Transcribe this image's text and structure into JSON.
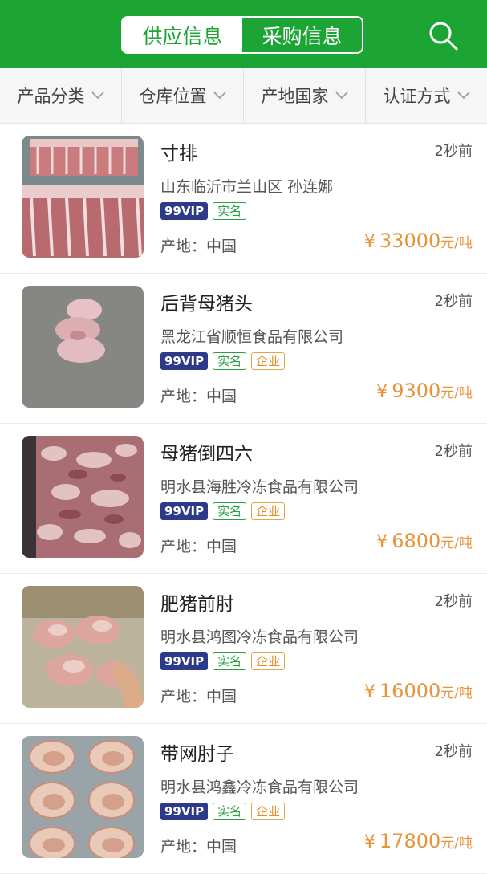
{
  "header": {
    "tabs": [
      {
        "label": "供应信息",
        "active": true
      },
      {
        "label": "采购信息",
        "active": false
      }
    ],
    "search_icon": "search-icon",
    "brand_color": "#1ca434"
  },
  "filters": [
    {
      "label": "产品分类"
    },
    {
      "label": "仓库位置"
    },
    {
      "label": "产地国家"
    },
    {
      "label": "认证方式"
    }
  ],
  "listings": [
    {
      "title": "寸排",
      "time": "2秒前",
      "company": "山东临沂市兰山区  孙连娜",
      "vip": "99VIP",
      "verified": "实名",
      "enterprise": "",
      "origin": "产地：中国",
      "currency": "¥",
      "price": "33000",
      "unit": "元/吨"
    },
    {
      "title": "后背母猪头",
      "time": "2秒前",
      "company": "黑龙江省顺恒食品有限公司",
      "vip": "99VIP",
      "verified": "实名",
      "enterprise": "企业",
      "origin": "产地：中国",
      "currency": "¥",
      "price": "9300",
      "unit": "元/吨"
    },
    {
      "title": "母猪倒四六",
      "time": "2秒前",
      "company": "明水县海胜冷冻食品有限公司",
      "vip": "99VIP",
      "verified": "实名",
      "enterprise": "企业",
      "origin": "产地：中国",
      "currency": "¥",
      "price": "6800",
      "unit": "元/吨"
    },
    {
      "title": "肥猪前肘",
      "time": "2秒前",
      "company": "明水县鸿图冷冻食品有限公司",
      "vip": "99VIP",
      "verified": "实名",
      "enterprise": "企业",
      "origin": "产地：中国",
      "currency": "¥",
      "price": "16000",
      "unit": "元/吨"
    },
    {
      "title": "带网肘子",
      "time": "2秒前",
      "company": "明水县鸿鑫冷冻食品有限公司",
      "vip": "99VIP",
      "verified": "实名",
      "enterprise": "企业",
      "origin": "产地：中国",
      "currency": "¥",
      "price": "17800",
      "unit": "元/吨"
    }
  ]
}
